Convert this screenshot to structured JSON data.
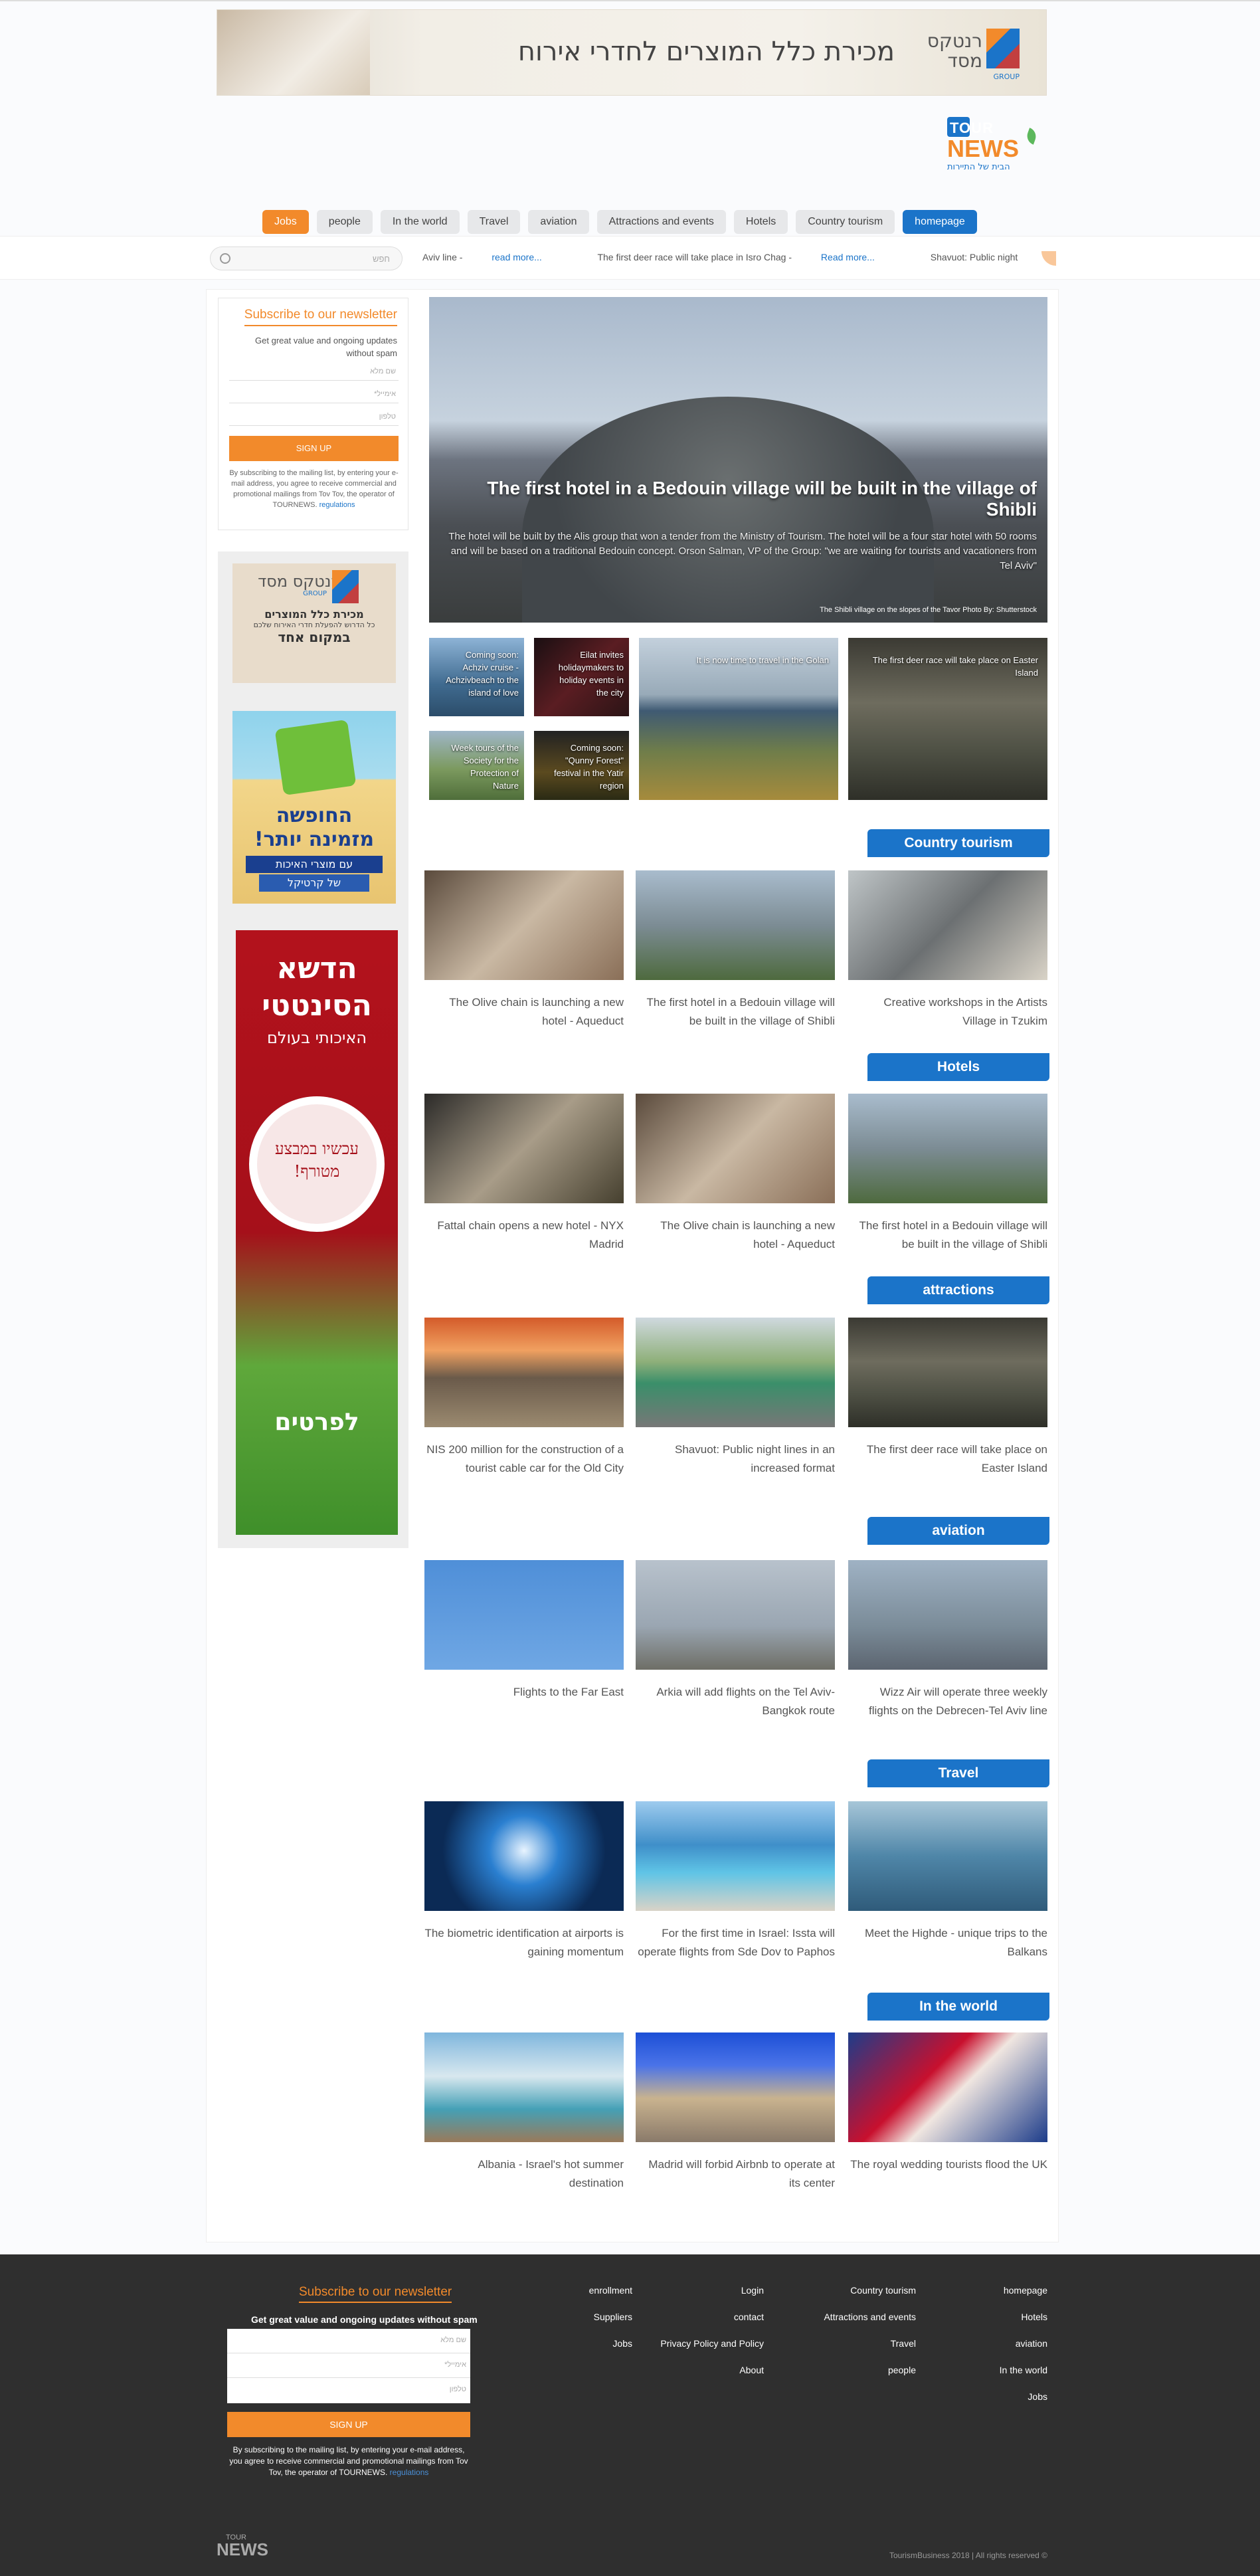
{
  "top_banner": {
    "text": "מכירת כלל המוצרים לחדרי אירוח",
    "brand": "רנטקס מסד",
    "brand_sub": "GROUP"
  },
  "site_logo": {
    "line1": "TOUR",
    "line2": "NEWS",
    "tagline": "הבית של התיירות"
  },
  "nav": [
    "Jobs",
    "people",
    "In the world",
    "Travel",
    "aviation",
    "Attractions and events",
    "Hotels",
    "Country tourism",
    "homepage"
  ],
  "search": {
    "placeholder": "חפש"
  },
  "ticker": [
    {
      "text": "Aviv line -",
      "more": "read more..."
    },
    {
      "text": "The first deer race will take place in Isro Chag -",
      "more": "Read more..."
    },
    {
      "text": "Shavuot: Public night lines in an increased format",
      "more": ""
    }
  ],
  "newsletter": {
    "title": "Subscribe to our newsletter",
    "subtitle": "Get great value and ongoing updates without spam",
    "fields": [
      "שם מלא",
      "אימייל*",
      "טלפון"
    ],
    "button": "SIGN UP",
    "fine": "By subscribing to the mailing list, by entering your e-mail address, you agree to receive commercial and promotional mailings from Tov Tov, the operator of TOURNEWS.",
    "regulations": "regulations"
  },
  "ads": {
    "ad1": {
      "brand": "רנטקס מסד",
      "brand_sub": "GROUP",
      "line1": "מכירת כלל המוצרים",
      "line2": "כל הדרוש להפעלת חדרי האירוח שלכם",
      "line3": "במקום אחד"
    },
    "ad2": {
      "line1": "החופשה",
      "line2": "מזמינה יותר!",
      "line3": "עם מוצרי האיכות",
      "line4": "של קרטיקל"
    },
    "ad3": {
      "line1": "הדשא",
      "line2": "הסינטטי",
      "line3": "האיכותי בעולם",
      "circle": "עכשיו במבצע מטורף!",
      "cta": "לפרטים"
    }
  },
  "hero": {
    "title": "The first hotel in a Bedouin village will be built in the village of Shibli",
    "desc": "The hotel will be built by the Alis group that won a tender from the Ministry of Tourism. The hotel will be a four star hotel with 50 rooms and will be based on a traditional Bedouin concept. Orson Salman, VP of the Group: \"we are waiting for tourists and vacationers from Tel Aviv\"",
    "caption": "The Shibli village on the slopes of the Tavor Photo By: Shutterstock"
  },
  "minis": [
    "Coming soon: Achziv cruise - Achzivbeach to the island of love",
    "Eilat invites holidaymakers to holiday events in the city",
    "Week tours of the Society for the Protection of Nature",
    "Coming soon: \"Qunny Forest\" festival in the Yatir region",
    "It is now time to travel in the Golan",
    "The first deer race will take place on Easter Island"
  ],
  "sections": [
    {
      "title": "Country tourism",
      "cards": [
        "The Olive chain is launching a new hotel - Aqueduct",
        "The first hotel in a Bedouin village will be built in the village of Shibli",
        "Creative workshops in the Artists Village in Tzukim"
      ]
    },
    {
      "title": "Hotels",
      "cards": [
        "Fattal chain opens a new hotel - NYX Madrid",
        "The Olive chain is launching a new hotel - Aqueduct",
        "The first hotel in a Bedouin village will be built in the village of Shibli"
      ]
    },
    {
      "title": "attractions",
      "cards": [
        "NIS 200 million for the construction of a tourist cable car for the Old City",
        "Shavuot: Public night lines in an increased format",
        "The first deer race will take place on Easter Island"
      ]
    },
    {
      "title": "aviation",
      "cards": [
        "Flights to the Far East",
        "Arkia will add flights on the Tel Aviv-Bangkok route",
        "Wizz Air will operate three weekly flights on the Debrecen-Tel Aviv line"
      ]
    },
    {
      "title": "Travel",
      "cards": [
        "The biometric identification at airports is gaining momentum",
        "For the first time in Israel: Issta will operate flights from Sde Dov to Paphos",
        "Meet the Highde - unique trips to the Balkans"
      ]
    },
    {
      "title": "In the world",
      "cards": [
        "Albania - Israel's hot summer destination",
        "Madrid will forbid Airbnb to operate at its center",
        "The royal wedding tourists flood the UK"
      ]
    }
  ],
  "footer": {
    "nl_title": "Subscribe to our newsletter",
    "nl_sub": "Get great value and ongoing updates without spam",
    "fields": [
      "שם מלא",
      "אימייל*",
      "טלפון"
    ],
    "button": "SIGN UP",
    "fine": "By subscribing to the mailing list, by entering your e-mail address, you agree to receive commercial and promotional mailings from Tov Tov, the operator of TOURNEWS.",
    "regulations": "regulations",
    "col1": [
      "enrollment",
      "Suppliers",
      "Jobs"
    ],
    "col2": [
      "Login",
      "contact",
      "Privacy Policy and Policy",
      "About"
    ],
    "col3": [
      "Country tourism",
      "Attractions and events",
      "Travel",
      "people"
    ],
    "col4": [
      "homepage",
      "Hotels",
      "aviation",
      "In the world",
      "Jobs"
    ],
    "logo1": "TOUR",
    "logo2": "NEWS",
    "copyright": "TourismBusiness 2018 | All rights reserved ©"
  },
  "colors": {
    "accent": "#f28a2b",
    "primary": "#1b74c9",
    "footer": "#2f2f2f"
  }
}
